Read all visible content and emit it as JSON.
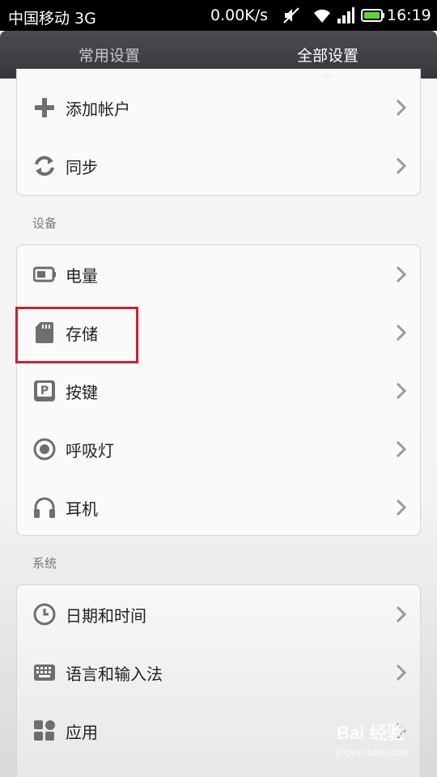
{
  "status_bar": {
    "carrier": "中国移动 3G",
    "speed": "0.00K/s",
    "time": "16:19",
    "icons": [
      "mute-icon",
      "wifi-icon",
      "signal-icon",
      "battery-icon"
    ]
  },
  "tabs": {
    "common": "常用设置",
    "all": "全部设置"
  },
  "accounts": {
    "items": [
      {
        "label": "添加帐户",
        "icon": "plus-icon"
      },
      {
        "label": "同步",
        "icon": "sync-icon"
      }
    ]
  },
  "device": {
    "title": "设备",
    "items": [
      {
        "label": "电量",
        "icon": "battery-icon"
      },
      {
        "label": "存储",
        "icon": "sd-card-icon"
      },
      {
        "label": "按键",
        "icon": "key-icon"
      },
      {
        "label": "呼吸灯",
        "icon": "led-icon"
      },
      {
        "label": "耳机",
        "icon": "headphones-icon"
      }
    ]
  },
  "system": {
    "title": "系统",
    "items": [
      {
        "label": "日期和时间",
        "icon": "clock-icon"
      },
      {
        "label": "语言和输入法",
        "icon": "keyboard-icon"
      },
      {
        "label": "应用",
        "icon": "apps-icon"
      }
    ]
  },
  "watermark": {
    "main": "Bai 经验",
    "sub": "jingyan.baidu.com"
  },
  "colors": {
    "highlight": "#d0202a",
    "tabbar": "#3e4045",
    "icon": "#6e6e6e"
  }
}
